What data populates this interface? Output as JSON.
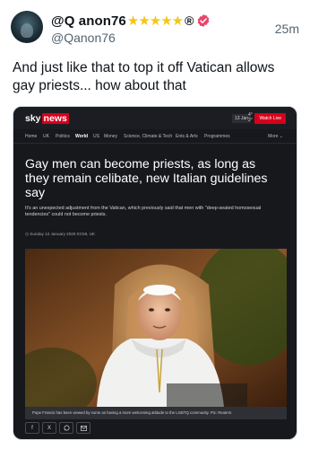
{
  "tweet": {
    "display_name": "@Q anon76",
    "stars": "★★★★★",
    "registered_mark": "®",
    "handle": "@Qanon76",
    "timestamp": "25m",
    "text": "And just like that to top it off Vatican allows gay priests... how about that"
  },
  "article": {
    "logo_sky": "sky",
    "logo_news": "news",
    "date_chip": "13 Jan",
    "weather_temp": "4°",
    "weather_unit": "2°",
    "watch_live": "Watch Live",
    "nav": [
      "Home",
      "UK",
      "Politics",
      "World",
      "US",
      "Money",
      "Science, Climate & Tech",
      "Ents & Arts",
      "Programmes"
    ],
    "nav_active": "World",
    "nav_more": "More",
    "headline": "Gay men can become priests, as long as they remain celibate, new Italian guidelines say",
    "standfirst": "It's an unexpected adjustment from the Vatican, which previously said that men with \"deep-seated homosexual tendencies\" could not become priests.",
    "dateline": "Sunday 12 January 2025 03:58, UK",
    "caption": "Pope Francis has been viewed by some as having a more welcoming attitude to the LGBTQ community. Pic: Reuters",
    "share": [
      "f",
      "X",
      "whatsapp",
      "email"
    ]
  },
  "colors": {
    "sky_red": "#d6001c",
    "star_gold": "#f5c518",
    "verified_badge": "#e8466b"
  },
  "icons": {
    "verified": "verified-badge-icon",
    "facebook": "facebook-icon",
    "x": "x-icon",
    "whatsapp": "whatsapp-icon",
    "email": "email-icon"
  }
}
